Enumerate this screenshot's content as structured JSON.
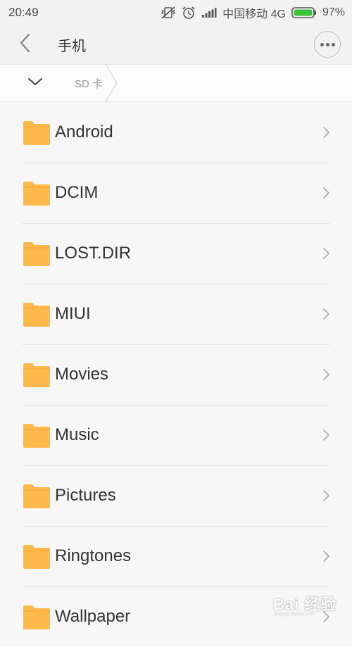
{
  "status_bar": {
    "time": "20:49",
    "carrier": "中国移动 4G",
    "battery": "97%",
    "icons": [
      "vibrate-off-icon",
      "alarm-icon",
      "signal-icon",
      "battery-icon"
    ],
    "battery_color": "#39c439"
  },
  "header": {
    "title": "手机",
    "back_icon": "chevron-left-icon",
    "more_icon": "more-dots-icon"
  },
  "breadcrumb": {
    "toggle_icon": "chevron-down-icon",
    "segments": [
      "SD 卡"
    ]
  },
  "files": [
    {
      "name": "Android",
      "icon": "folder-icon"
    },
    {
      "name": "DCIM",
      "icon": "folder-icon"
    },
    {
      "name": "LOST.DIR",
      "icon": "folder-icon"
    },
    {
      "name": "MIUI",
      "icon": "folder-icon"
    },
    {
      "name": "Movies",
      "icon": "folder-icon"
    },
    {
      "name": "Music",
      "icon": "folder-icon"
    },
    {
      "name": "Pictures",
      "icon": "folder-icon"
    },
    {
      "name": "Ringtones",
      "icon": "folder-icon"
    },
    {
      "name": "Wallpaper",
      "icon": "folder-icon"
    }
  ],
  "colors": {
    "folder": "#fdb94a",
    "folder_dark": "#f2a531",
    "background": "#f7f7f7",
    "header_bg": "#f2f2f2"
  },
  "watermark": {
    "text": "Bai 经验",
    "sub": "jingyan.baidu.com"
  }
}
